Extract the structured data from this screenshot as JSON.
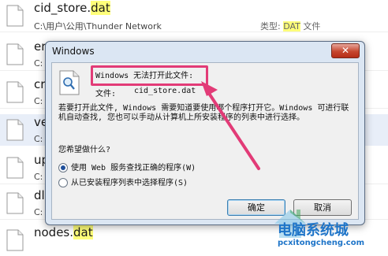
{
  "background_list": {
    "rows": [
      {
        "name": "cid_store.dat",
        "name_stem": "cid_store.",
        "name_ext": "dat",
        "path": "C:\\用户\\公用\\Thunder Network",
        "type_label": "类型: ",
        "type_ext": "DAT",
        "type_rest": " 文件"
      },
      {
        "name_partial": "er",
        "path_partial": "C:"
      },
      {
        "name_partial": "cr",
        "path_partial": "C:"
      },
      {
        "name_partial": "ve",
        "path_partial": "C:"
      },
      {
        "name_partial": "up",
        "path_partial": "C:"
      },
      {
        "name_partial": "dl",
        "path_partial": "C:"
      },
      {
        "name": "nodes.dat",
        "name_stem": "nodes.",
        "name_ext": "dat"
      }
    ]
  },
  "dialog": {
    "title": "Windows",
    "close_glyph": "✕",
    "message": "Windows 无法打开此文件:",
    "file_label": "文件:",
    "file_name": "cid_store.dat",
    "description": "若要打开此文件, Windows 需要知道要使用哪个程序打开它。Windows 可进行联机自动查找, 您也可以手动从计算机上所安装程序的列表中进行选择。",
    "question": "您希望做什么?",
    "options": [
      {
        "label": "使用 Web 服务查找正确的程序(W)",
        "selected": true
      },
      {
        "label": "从已安装程序列表中选择程序(S)",
        "selected": false
      }
    ],
    "ok_label": "确定",
    "cancel_label": "取消"
  },
  "annotation": {
    "highlight_color": "#e23b77"
  },
  "watermark": {
    "title": "电脑系统城",
    "url": "pcxitongcheng.com"
  }
}
